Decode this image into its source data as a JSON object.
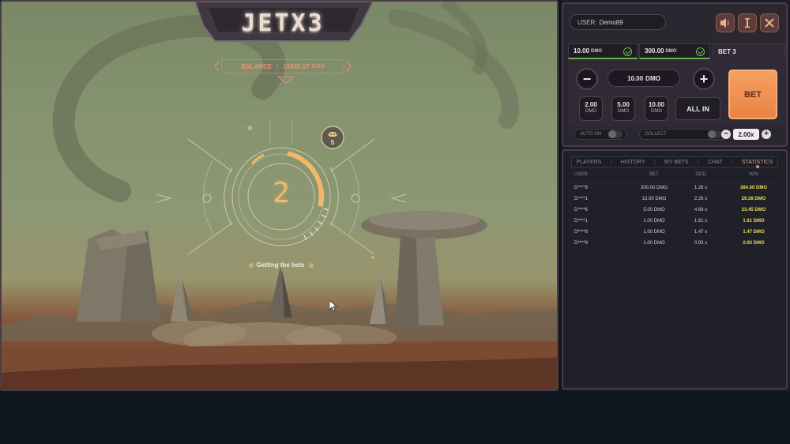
{
  "game": {
    "logo": "JETX3",
    "balance_label": "BALANCE",
    "balance_value": "19645.07",
    "balance_unit": "DMO",
    "counter": "2",
    "players_count": "5",
    "status": "Getting the bets"
  },
  "panel": {
    "user_label": "USER:",
    "user_name": "Demo89",
    "bet_tabs": [
      {
        "value": "10.00",
        "unit": "DMO"
      },
      {
        "value": "300.00",
        "unit": "DMO"
      },
      {
        "label": "BET 3"
      }
    ],
    "amount_value": "10.00",
    "amount_unit": "DMO",
    "minus_label": "−",
    "plus_label": "+",
    "chips": [
      {
        "value": "2.00",
        "unit": "DMO"
      },
      {
        "value": "5.00",
        "unit": "DMO"
      },
      {
        "value": "10.00",
        "unit": "DMO"
      }
    ],
    "all_in_label": "ALL IN",
    "bet_label": "BET",
    "auto_on_label": "AUTO ON",
    "collect_label": "COLLECT",
    "collect_value": "2.00x",
    "collect_minus": "−",
    "collect_plus": "+"
  },
  "tabs": [
    "PLAYERS",
    "HISTORY",
    "MY BETS",
    "CHAT",
    "STATISTICS"
  ],
  "active_tab": "STATISTICS",
  "table": {
    "headers": {
      "user": "USER",
      "bet": "BET",
      "odd": "ODD",
      "win": "WIN"
    },
    "rows": [
      {
        "user": "D****9",
        "bet": "300.00 DMO",
        "odd": "1.28 x",
        "win": "384.00 DMO"
      },
      {
        "user": "D****1",
        "bet": "13.00 DMO",
        "odd": "2.26 x",
        "win": "29.38 DMO"
      },
      {
        "user": "D****6",
        "bet": "5.00 DMO",
        "odd": "4.69 x",
        "win": "23.45 DMO"
      },
      {
        "user": "D****1",
        "bet": "1.00 DMO",
        "odd": "1.61 x",
        "win": "1.61 DMO"
      },
      {
        "user": "D****8",
        "bet": "1.00 DMO",
        "odd": "1.47 x",
        "win": "1.47 DMO"
      },
      {
        "user": "D****9",
        "bet": "1.00 DMO",
        "odd": "0.93 x",
        "win": "0.93 DMO"
      }
    ]
  },
  "icons": {
    "sound": "sound-icon",
    "info": "info-icon",
    "close": "close-icon",
    "check": "check-icon",
    "alien": "alien-icon"
  },
  "colors": {
    "accent_orange": "#ea8443",
    "win_yellow": "#e9dd4d",
    "check_green": "#73c15a",
    "balance_salmon": "#e8937a",
    "counter_amber": "#f2b86a"
  }
}
